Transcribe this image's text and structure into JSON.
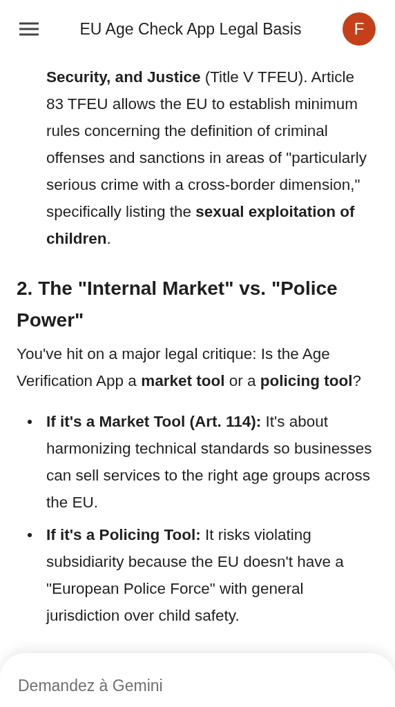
{
  "header": {
    "title": "EU Age Check App Legal Basis",
    "avatar_letter": "F"
  },
  "blocks": [
    {
      "kind": "continuation",
      "text": "**Security, and Justice** (Title V TFEU). Article 83 TFEU allows the EU to establish minimum rules concerning the definition of criminal offenses and sanctions in areas of \"particularly serious crime with a cross-border dimension,\" specifically listing the **sexual exploitation of children**."
    },
    {
      "kind": "heading",
      "text": "2. The \"Internal Market\" vs. \"Police Power\""
    },
    {
      "kind": "paragraph",
      "text": "You've hit on a major legal critique: Is the Age Verification App a **market tool** or a **policing tool**?"
    },
    {
      "kind": "bullets",
      "items": [
        {
          "text": "**If it's a Market Tool (Art. 114):** It's about harmonizing technical standards so businesses can sell services to the right age groups across the EU."
        },
        {
          "text": "**If it's a Policing Tool:** It risks violating subsidiarity because the EU doesn't have a \"European Police Force\" with general jurisdiction over child safety."
        }
      ]
    }
  ],
  "prompt": {
    "placeholder": "Demandez à Gemini"
  }
}
